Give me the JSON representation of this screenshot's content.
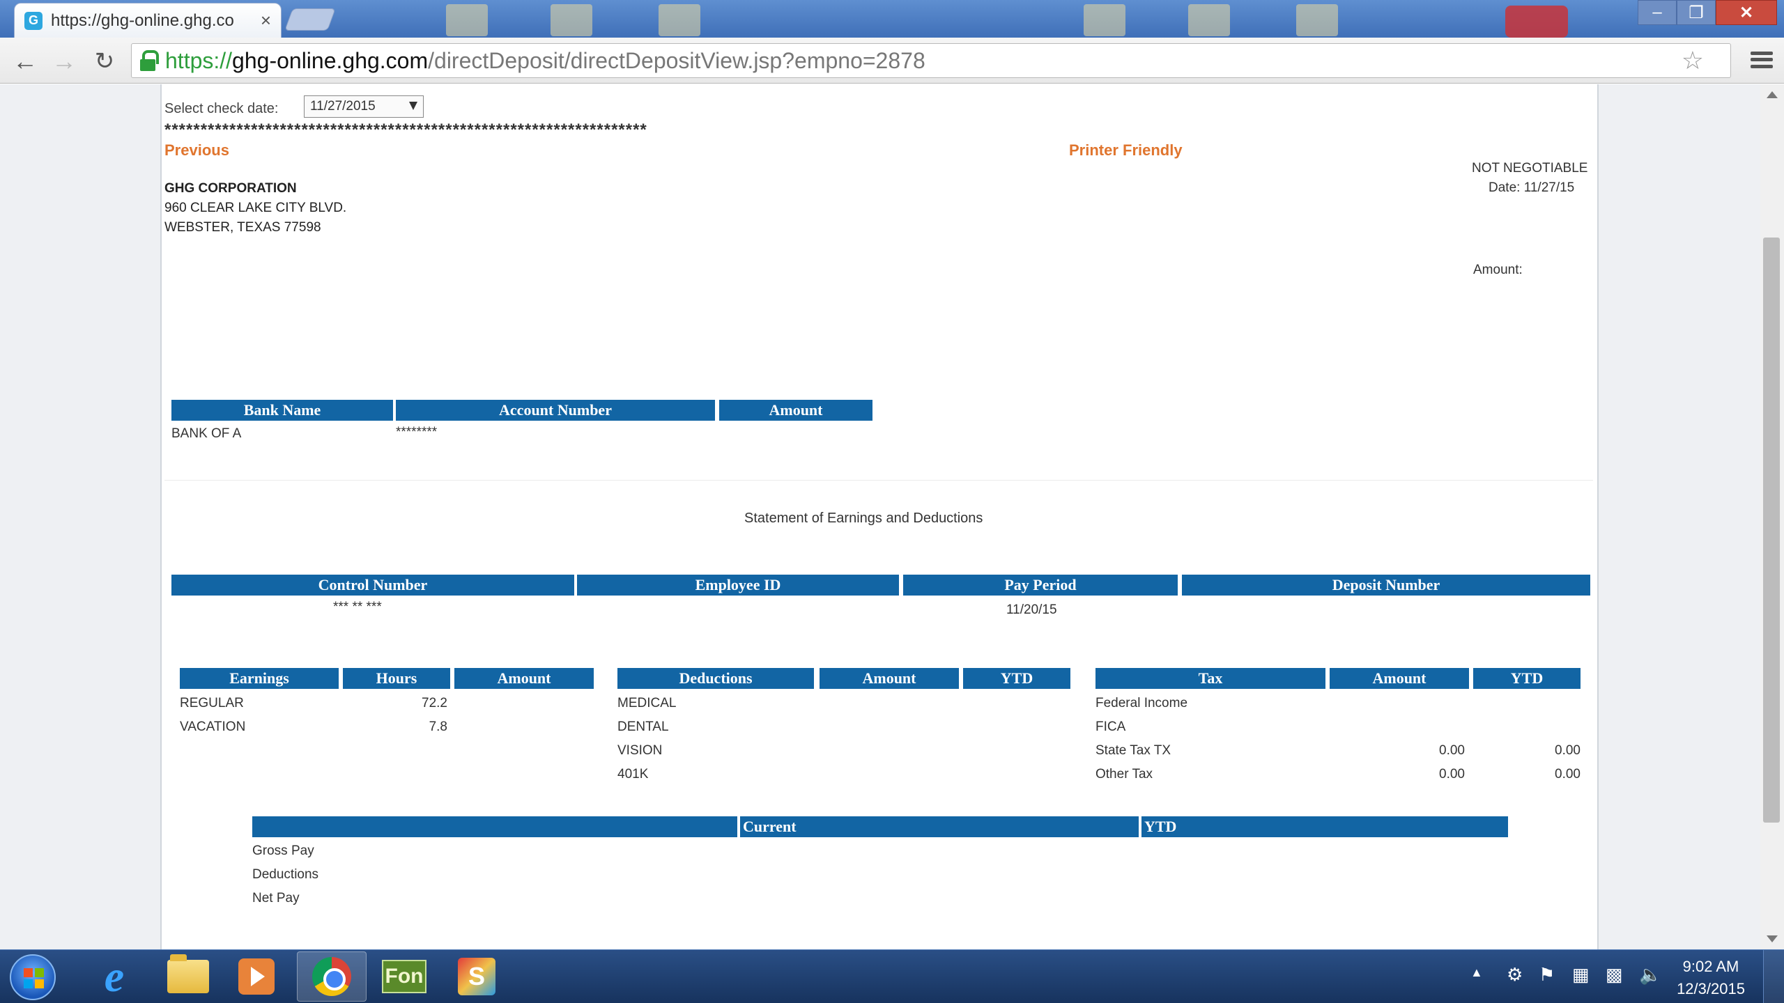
{
  "browser": {
    "tab_title": "https://ghg-online.ghg.co",
    "tab_close": "×",
    "url_scheme": "https://",
    "url_host": "ghg-online.ghg.com",
    "url_path": "/directDeposit/directDepositView.jsp?empno=2878",
    "window_buttons": {
      "minimize": "–",
      "maximize": "❐",
      "close": "✕"
    },
    "icons": {
      "back": "arrow-left-icon",
      "forward": "arrow-right-icon",
      "reload": "reload-icon",
      "bookmark": "star-icon",
      "menu": "hamburger-icon"
    }
  },
  "page": {
    "select_label": "Select check date:",
    "check_date": "11/27/2015",
    "separator": "*******************************************************************",
    "previous_link": "Previous",
    "printer_link": "Printer Friendly",
    "not_negotiable": "NOT NEGOTIABLE",
    "date_line": "Date: 11/27/15",
    "amount_label": "Amount:",
    "company": {
      "name": "GHG CORPORATION",
      "address1": "960 CLEAR LAKE CITY BLVD.",
      "address2": "WEBSTER, TEXAS 77598"
    },
    "bank_table": {
      "headers": [
        "Bank Name",
        "Account Number",
        "Amount"
      ],
      "row": {
        "bank": "BANK OF A",
        "account": "********",
        "amount": ""
      }
    },
    "statement_title": "Statement of Earnings and Deductions",
    "info_table": {
      "headers": [
        "Control Number",
        "Employee ID",
        "Pay Period",
        "Deposit Number"
      ],
      "row": {
        "control": "*** ** ***",
        "employee": "",
        "period": "11/20/15",
        "deposit": ""
      }
    },
    "earnings": {
      "headers": [
        "Earnings",
        "Hours",
        "Amount"
      ],
      "rows": [
        {
          "label": "REGULAR",
          "hours": "72.2",
          "amount": ""
        },
        {
          "label": "VACATION",
          "hours": "7.8",
          "amount": ""
        }
      ]
    },
    "deductions": {
      "headers": [
        "Deductions",
        "Amount",
        "YTD"
      ],
      "rows": [
        {
          "label": "MEDICAL",
          "amount": "",
          "ytd": ""
        },
        {
          "label": "DENTAL",
          "amount": "",
          "ytd": ""
        },
        {
          "label": "VISION",
          "amount": "",
          "ytd": ""
        },
        {
          "label": "401K",
          "amount": "",
          "ytd": ""
        }
      ]
    },
    "tax": {
      "headers": [
        "Tax",
        "Amount",
        "YTD"
      ],
      "rows": [
        {
          "label": "Federal Income",
          "amount": "",
          "ytd": ""
        },
        {
          "label": "FICA",
          "amount": "",
          "ytd": ""
        },
        {
          "label": "State Tax TX",
          "amount": "0.00",
          "ytd": "0.00"
        },
        {
          "label": "Other Tax",
          "amount": "0.00",
          "ytd": "0.00"
        }
      ]
    },
    "summary": {
      "headers": [
        "",
        "Current",
        "YTD"
      ],
      "rows": [
        "Gross Pay",
        "Deductions",
        "Net Pay"
      ]
    }
  },
  "taskbar": {
    "apps": [
      "start-button",
      "internet-explorer-icon",
      "file-explorer-icon",
      "media-player-icon",
      "chrome-icon",
      "fon-app-icon",
      "s-app-icon"
    ],
    "fon_label": "Fon",
    "s_label": "S",
    "time": "9:02 AM",
    "date": "12/3/2015"
  }
}
